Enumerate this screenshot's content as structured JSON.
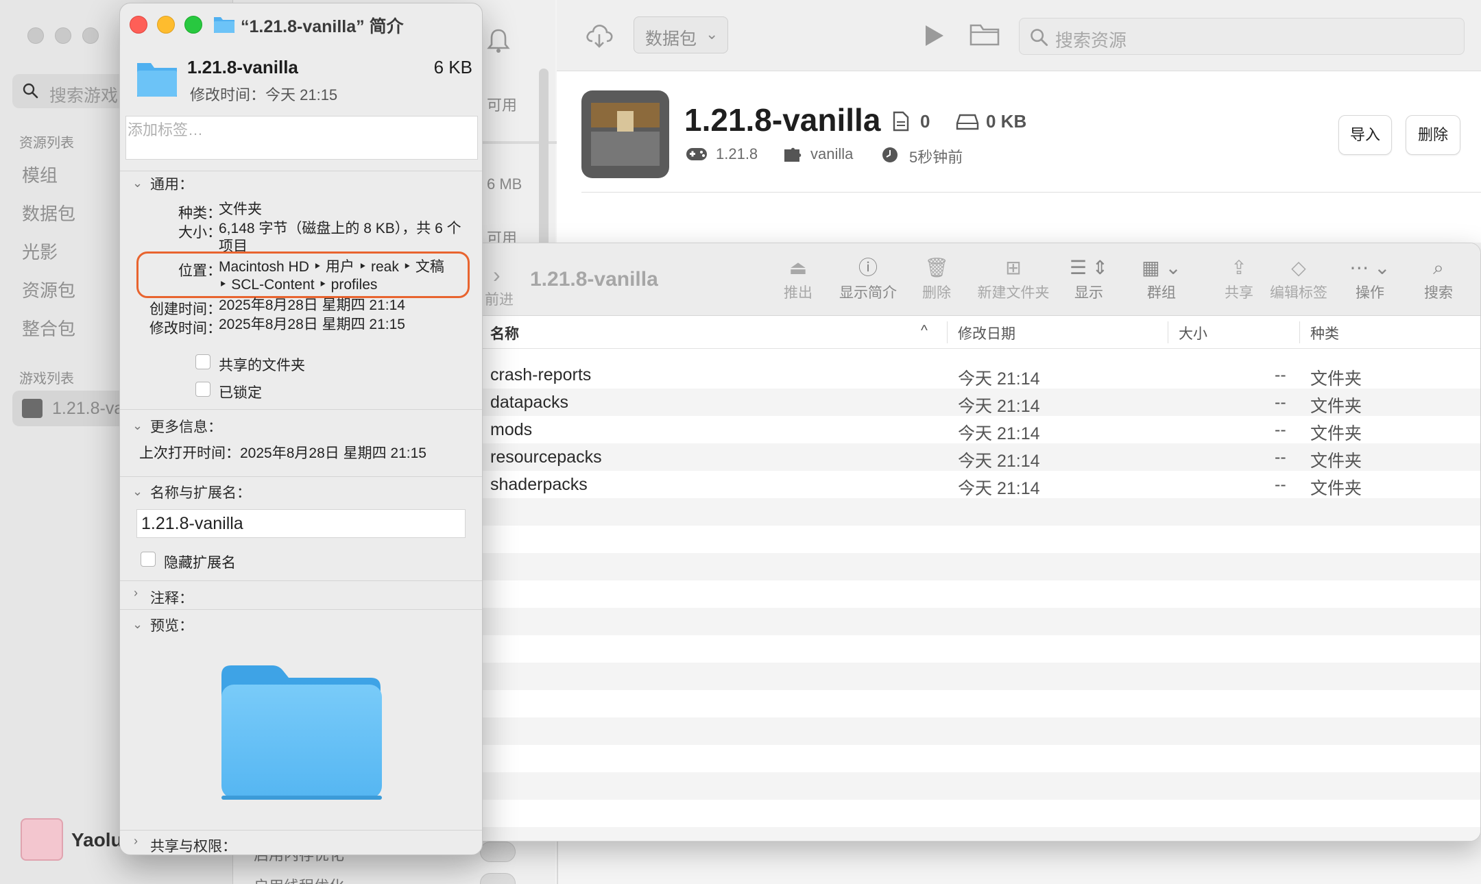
{
  "sidebar": {
    "search_placeholder": "搜索游戏",
    "resources_heading": "资源列表",
    "resources": [
      "模组",
      "数据包",
      "光影",
      "资源包",
      "整合包"
    ],
    "games_heading": "游戏列表",
    "game_item": "1.21.8-va",
    "user_name": "Yaolu"
  },
  "middle": {
    "texts": [
      "可用",
      "6 MB",
      "可用"
    ],
    "bottom_texts": [
      "启用内存优化",
      "启用线程优化"
    ]
  },
  "toolbar": {
    "dropdown_label": "数据包",
    "search_placeholder": "搜索资源"
  },
  "profile": {
    "title": "1.21.8-vanilla",
    "file_count": "0",
    "disk_size": "0 KB",
    "version": "1.21.8",
    "loader": "vanilla",
    "last_played": "5秒钟前",
    "import_label": "导入",
    "delete_label": "删除"
  },
  "finder": {
    "nav_label": "前进",
    "title": "1.21.8-vanilla",
    "tools": [
      "推出",
      "显示简介",
      "删除",
      "新建文件夹",
      "显示",
      "群组",
      "共享",
      "编辑标签",
      "操作",
      "搜索"
    ],
    "columns": {
      "name": "名称",
      "modified": "修改日期",
      "size": "大小",
      "kind": "种类"
    },
    "rows": [
      {
        "name": "crash-reports",
        "modified": "今天 21:14",
        "size": "--",
        "kind": "文件夹"
      },
      {
        "name": "datapacks",
        "modified": "今天 21:14",
        "size": "--",
        "kind": "文件夹"
      },
      {
        "name": "mods",
        "modified": "今天 21:14",
        "size": "--",
        "kind": "文件夹"
      },
      {
        "name": "resourcepacks",
        "modified": "今天 21:14",
        "size": "--",
        "kind": "文件夹"
      },
      {
        "name": "shaderpacks",
        "modified": "今天 21:14",
        "size": "--",
        "kind": "文件夹"
      }
    ]
  },
  "info": {
    "window_title": "“1.21.8-vanilla” 简介",
    "name": "1.21.8-vanilla",
    "size": "6 KB",
    "modified": "修改时间：今天 21:15",
    "tags_placeholder": "添加标签…",
    "general": {
      "heading": "通用：",
      "kind_key": "种类：",
      "kind_val": "文件夹",
      "size_key": "大小：",
      "size_val_1": "6,148 字节（磁盘上的 8 KB），共 6 个",
      "size_val_2": "项目",
      "where_key": "位置：",
      "where_val_1": "Macintosh HD ‣ 用户 ‣ reak ‣ 文稿",
      "where_val_2": "‣ SCL-Content ‣ profiles",
      "created_key": "创建时间：",
      "created_val": "2025年8月28日 星期四 21:14",
      "modified_key": "修改时间：",
      "modified_val": "2025年8月28日 星期四 21:15",
      "shared_label": "共享的文件夹",
      "locked_label": "已锁定"
    },
    "more": {
      "heading": "更多信息：",
      "last_opened": "上次打开时间：2025年8月28日 星期四 21:15"
    },
    "name_ext": {
      "heading": "名称与扩展名：",
      "value": "1.21.8-vanilla",
      "hide_ext_label": "隐藏扩展名"
    },
    "comments_heading": "注释：",
    "preview_heading": "预览：",
    "sharing_heading": "共享与权限："
  },
  "colors": {
    "folder_blue": "#5bb8f5",
    "highlight": "#e8642f",
    "close": "#fe5f57",
    "minimize": "#febc2e",
    "zoom": "#28c840"
  }
}
